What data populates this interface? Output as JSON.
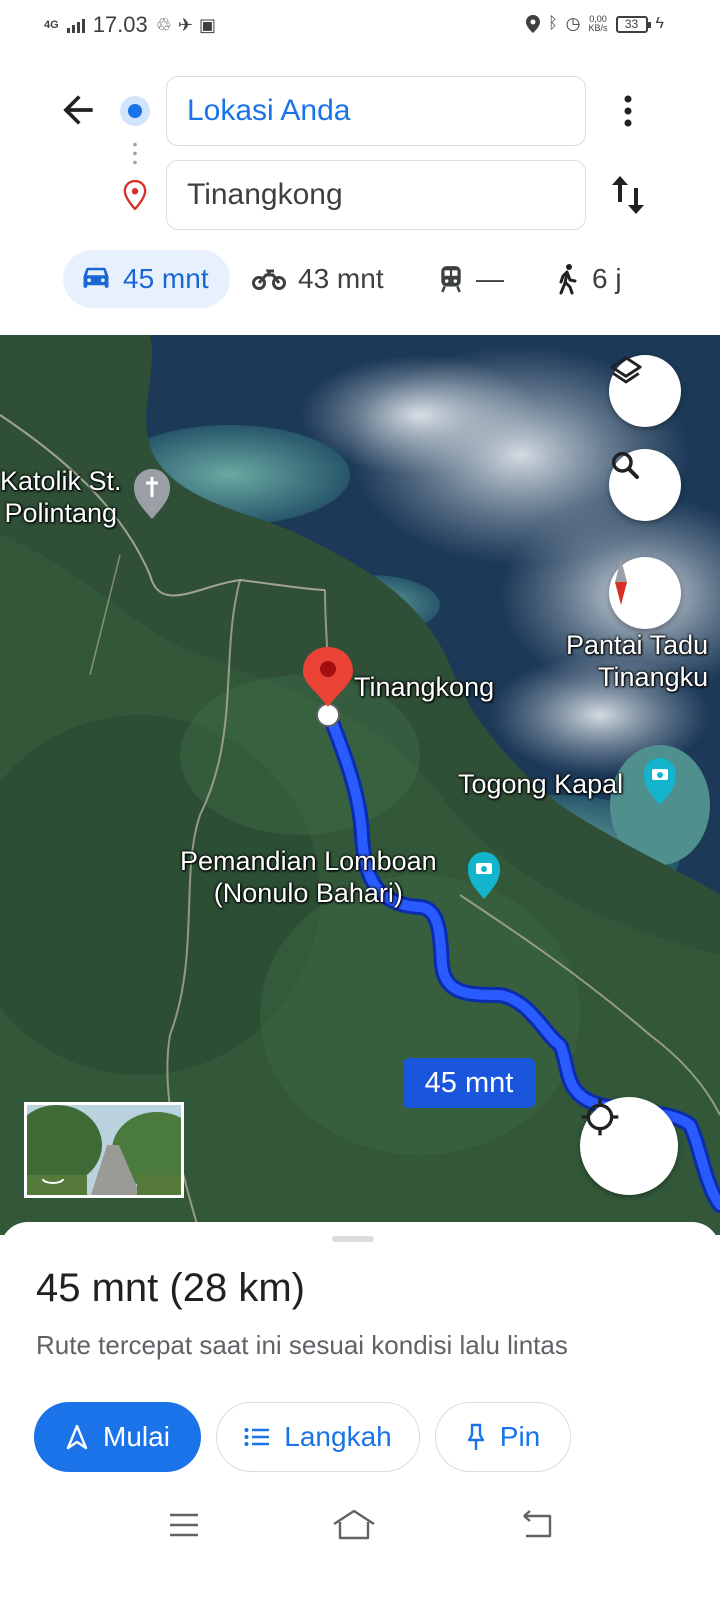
{
  "status_bar": {
    "network": "4G",
    "time": "17.03",
    "net_speed_value": "0,00",
    "net_speed_unit": "KB/s",
    "battery": "33"
  },
  "search": {
    "origin": "Lokasi Anda",
    "destination": "Tinangkong"
  },
  "modes": [
    {
      "label": "45 mnt",
      "icon": "car-icon",
      "active": true
    },
    {
      "label": "43 mnt",
      "icon": "motorcycle-icon",
      "active": false
    },
    {
      "label": "—",
      "icon": "transit-icon",
      "active": false
    },
    {
      "label": "6 j",
      "icon": "walk-icon",
      "active": false
    }
  ],
  "map": {
    "labels": {
      "church": "Katolik St.\nPolintang",
      "destination": "Tinangkong",
      "beach": "Pantai Tadu\nTinangku",
      "togong": "Togong Kapal",
      "pemandian": "Pemandian Lomboan\n(Nonulo Bahari)"
    },
    "route_duration": "45 mnt",
    "colors": {
      "route": "#1a56db",
      "pin": "#ea4335"
    }
  },
  "sheet": {
    "duration": "45 mnt",
    "distance": "(28 km)",
    "description": "Rute tercepat saat ini sesuai kondisi lalu lintas",
    "buttons": {
      "start": "Mulai",
      "steps": "Langkah",
      "pin": "Pin"
    }
  }
}
